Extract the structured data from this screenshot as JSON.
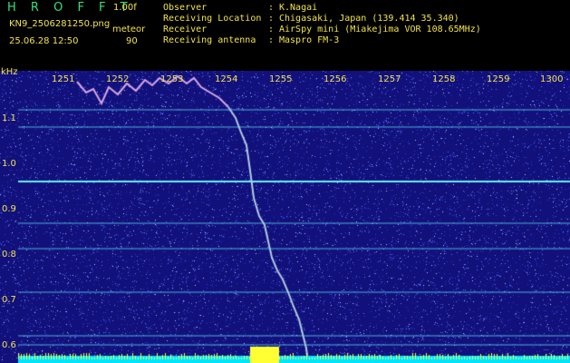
{
  "header": {
    "app_title": "H R O F F T",
    "version": "1.00f",
    "filename": "KN9_2506281250.png",
    "mode_label": "meteor",
    "timestamp": "25.06.28 12:50",
    "count_value": "90",
    "meta": [
      {
        "label": "Observer",
        "sep": ":",
        "value": "K.Nagai"
      },
      {
        "label": "Receiving Location",
        "sep": ":",
        "value": "Chigasaki, Japan (139.414 35.340)"
      },
      {
        "label": "Receiver",
        "sep": ":",
        "value": "AirSpy mini (Miakejima VOR 108.65MHz)"
      },
      {
        "label": "Receiving antenna",
        "sep": ":",
        "value": "Maspro FM-3"
      }
    ]
  },
  "axes": {
    "y_unit": "kHz",
    "x_ticks": [
      "1251",
      "1252",
      "1253",
      "1254",
      "1255",
      "1256",
      "1257",
      "1258",
      "1259",
      "1300"
    ],
    "y_ticks": [
      "1.1",
      "1.0",
      "0.9",
      "0.8",
      "0.7",
      "0.6"
    ]
  },
  "colors": {
    "background": "#12107a",
    "noise": "#3a5cff",
    "trace": "#d8a6e6",
    "carrier": "#5fe6ff",
    "label": "#f2e34a",
    "title": "#36e07a",
    "baseline": "#00e5ff",
    "burst": "#ffff33"
  }
}
